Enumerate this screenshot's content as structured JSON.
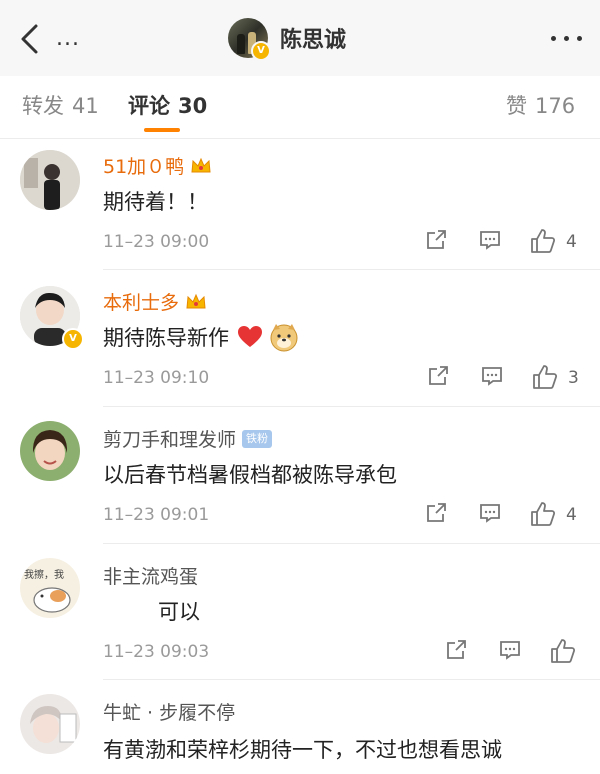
{
  "header": {
    "title": "陈思诚",
    "menu_dots": "...",
    "back_icon": "chevron-left-icon",
    "more_icon": "more-horizontal-icon"
  },
  "tabs": [
    {
      "label": "转发",
      "count": "41"
    },
    {
      "label": "评论",
      "count": "30",
      "active": true
    },
    {
      "label": "赞",
      "count": "176"
    }
  ],
  "colors": {
    "accent": "#ff8200",
    "vip_name": "#e86b0c",
    "verified_badge": "#f6b500",
    "fan_badge": "#a7c7ec"
  },
  "comments": [
    {
      "name": "51加０鸭",
      "vip": true,
      "text": "期待着！！",
      "time": "11–23 09:00",
      "likes": "4"
    },
    {
      "name": "本利士多",
      "vip": true,
      "verified": true,
      "text": "期待陈导新作",
      "emojis": [
        "heart",
        "doge"
      ],
      "time": "11–23 09:10",
      "likes": "3"
    },
    {
      "name": "剪刀手和理发师",
      "badge": "铁粉",
      "text": "以后春节档暑假档都被陈导承包",
      "time": "11–23 09:01",
      "likes": "4"
    },
    {
      "name": "非主流鸡蛋",
      "avatar_text": "我擦，我",
      "text": "可以",
      "time": "11–23 09:03",
      "likes": ""
    },
    {
      "name": "牛虻 · 步履不停",
      "text": "有黄渤和荣梓杉期待一下，不过也想看思诚"
    }
  ]
}
